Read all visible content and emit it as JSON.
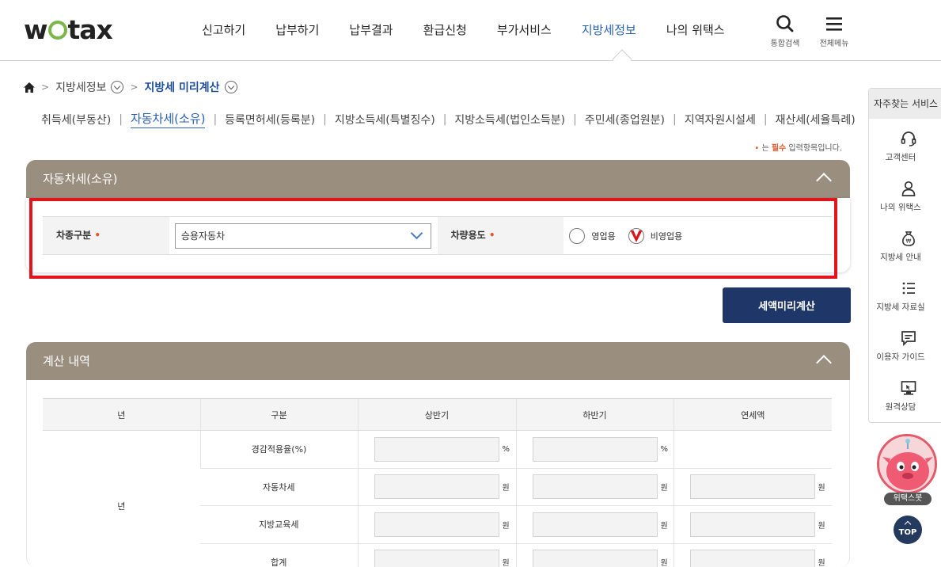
{
  "header": {
    "logo_left": "w",
    "logo_right": "tax",
    "nav": [
      "신고하기",
      "납부하기",
      "납부결과",
      "환급신청",
      "부가서비스",
      "지방세정보",
      "나의 위택스"
    ],
    "active_index": 5,
    "search_label": "통합검색",
    "menu_label": "전체메뉴"
  },
  "breadcrumb": {
    "level1": "지방세정보",
    "current": "지방세 미리계산"
  },
  "subtabs": [
    "취득세(부동산)",
    "자동차세(소유)",
    "등록면허세(등록분)",
    "지방소득세(특별징수)",
    "지방소득세(법인소득분)",
    "주민세(종업원분)",
    "지역자원시설세",
    "재산세(세율특례)"
  ],
  "required_note": {
    "dot": "•",
    "pre": "는 ",
    "must": "필수",
    "post": " 입력항목입니다."
  },
  "form_panel": {
    "title": "자동차세(소유)",
    "vehicle_type_label": "차종구분",
    "vehicle_type_value": "승용자동차",
    "usage_label": "차량용도",
    "usage_options": [
      "영업용",
      "비영업용"
    ],
    "usage_selected_index": 1,
    "required_mark": "•"
  },
  "calc_button": "세액미리계산",
  "result_panel": {
    "title": "계산 내역",
    "headers": [
      "년",
      "구분",
      "상반기",
      "하반기",
      "연세액"
    ],
    "year_cell": "년",
    "rows": [
      {
        "label": "경감적용율(%)",
        "unit_h1": "%",
        "unit_h2": "%",
        "unit_year": ""
      },
      {
        "label": "자동차세",
        "unit_h1": "원",
        "unit_h2": "원",
        "unit_year": "원"
      },
      {
        "label": "지방교육세",
        "unit_h1": "원",
        "unit_h2": "원",
        "unit_year": "원"
      },
      {
        "label": "합계",
        "unit_h1": "원",
        "unit_h2": "원",
        "unit_year": "원"
      }
    ]
  },
  "quick_menu": {
    "title": "자주찾는 서비스",
    "items": [
      "고객센터",
      "나의 위택스",
      "지방세 안내",
      "지방세 자료실",
      "이용자 가이드",
      "원격상담"
    ]
  },
  "bot_label": "위택스봇",
  "top_label": "TOP",
  "colors": {
    "accent_blue": "#2a5fb0",
    "panel_header": "#9a8f7e",
    "button_navy": "#1f3668",
    "required": "#e05a2b",
    "highlight": "#e3141c",
    "logo_green": "#7ab648"
  }
}
